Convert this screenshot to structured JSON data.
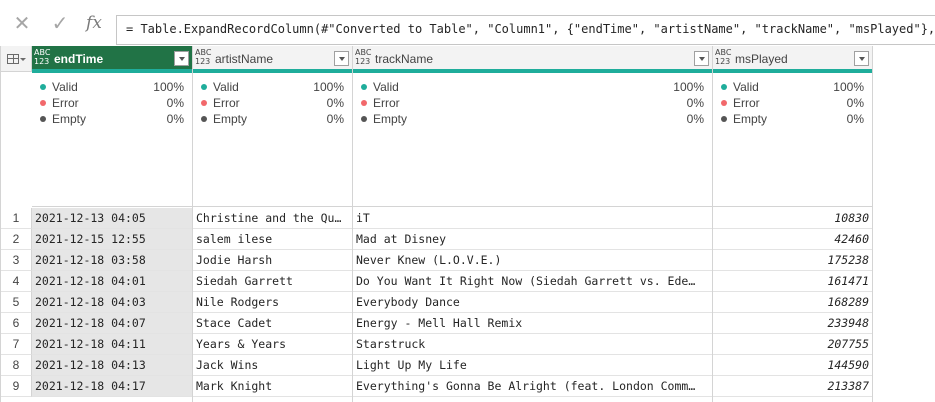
{
  "formula_bar": {
    "cancel_icon": "✕",
    "commit_icon": "✓",
    "fx_label": "fx",
    "formula": "= Table.ExpandRecordColumn(#\"Converted to Table\", \"Column1\", {\"endTime\", \"artistName\", \"trackName\", \"msPlayed\"}, {\"endTime\""
  },
  "grid": {
    "corner_icon": "table-icon",
    "columns": [
      {
        "name": "endTime",
        "type_label_top": "ABC",
        "type_label_bottom": "123",
        "selected": true,
        "quality": {
          "valid_label": "Valid",
          "valid": "100%",
          "error_label": "Error",
          "error": "0%",
          "empty_label": "Empty",
          "empty": "0%"
        }
      },
      {
        "name": "artistName",
        "type_label_top": "ABC",
        "type_label_bottom": "123",
        "selected": false,
        "quality": {
          "valid_label": "Valid",
          "valid": "100%",
          "error_label": "Error",
          "error": "0%",
          "empty_label": "Empty",
          "empty": "0%"
        }
      },
      {
        "name": "trackName",
        "type_label_top": "ABC",
        "type_label_bottom": "123",
        "selected": false,
        "quality": {
          "valid_label": "Valid",
          "valid": "100%",
          "error_label": "Error",
          "error": "0%",
          "empty_label": "Empty",
          "empty": "0%"
        }
      },
      {
        "name": "msPlayed",
        "type_label_top": "ABC",
        "type_label_bottom": "123",
        "selected": false,
        "quality": {
          "valid_label": "Valid",
          "valid": "100%",
          "error_label": "Error",
          "error": "0%",
          "empty_label": "Empty",
          "empty": "0%"
        }
      }
    ],
    "rows": [
      {
        "n": "1",
        "endTime": "2021-12-13 04:05",
        "artistName": "Christine and the Qu…",
        "trackName": "iT",
        "msPlayed": "10830"
      },
      {
        "n": "2",
        "endTime": "2021-12-15 12:55",
        "artistName": "salem ilese",
        "trackName": "Mad at Disney",
        "msPlayed": "42460"
      },
      {
        "n": "3",
        "endTime": "2021-12-18 03:58",
        "artistName": "Jodie Harsh",
        "trackName": "Never Knew (L.O.V.E.)",
        "msPlayed": "175238"
      },
      {
        "n": "4",
        "endTime": "2021-12-18 04:01",
        "artistName": "Siedah Garrett",
        "trackName": "Do You Want It Right Now (Siedah Garrett vs. Ede…",
        "msPlayed": "161471"
      },
      {
        "n": "5",
        "endTime": "2021-12-18 04:03",
        "artistName": "Nile Rodgers",
        "trackName": "Everybody Dance",
        "msPlayed": "168289"
      },
      {
        "n": "6",
        "endTime": "2021-12-18 04:07",
        "artistName": "Stace Cadet",
        "trackName": "Energy - Mell Hall Remix",
        "msPlayed": "233948"
      },
      {
        "n": "7",
        "endTime": "2021-12-18 04:11",
        "artistName": "Years & Years",
        "trackName": "Starstruck",
        "msPlayed": "207755"
      },
      {
        "n": "8",
        "endTime": "2021-12-18 04:13",
        "artistName": "Jack Wins",
        "trackName": "Light Up My Life",
        "msPlayed": "144590"
      },
      {
        "n": "9",
        "endTime": "2021-12-18 04:17",
        "artistName": "Mark Knight",
        "trackName": "Everything's Gonna Be Alright (feat. London Comm…",
        "msPlayed": "213387"
      }
    ]
  },
  "colors": {
    "valid": "#1fad9b",
    "error": "#f2686b",
    "empty": "#555555",
    "selected_header": "#217346"
  }
}
